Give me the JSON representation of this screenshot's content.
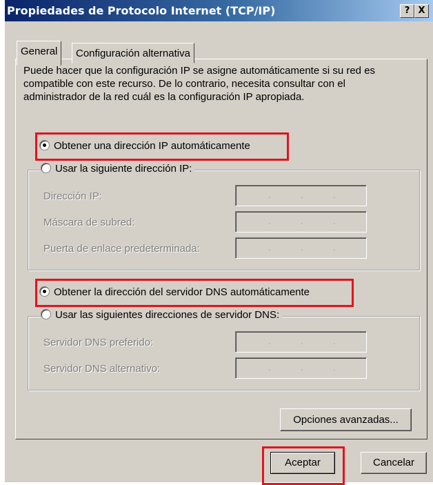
{
  "window": {
    "title": "Propiedades de Protocolo Internet (TCP/IP)",
    "help_label": "?",
    "close_label": "X"
  },
  "tabs": [
    {
      "label": "General"
    },
    {
      "label": "Configuración alternativa"
    }
  ],
  "intro_text": "Puede hacer que la configuración IP se asigne automáticamente si su red es compatible con este recurso. De lo contrario, necesita consultar con el administrador de la red cuál es la configuración IP apropiada.",
  "ip": {
    "auto_label": "Obtener una dirección IP automáticamente",
    "manual_label": "Usar la siguiente dirección IP:",
    "fields": [
      {
        "label": "Dirección IP:"
      },
      {
        "label": "Máscara de subred:"
      },
      {
        "label": "Puerta de enlace predeterminada:"
      }
    ]
  },
  "dns": {
    "auto_label": "Obtener la dirección del servidor DNS automáticamente",
    "manual_label": "Usar las siguientes direcciones de servidor DNS:",
    "fields": [
      {
        "label": "Servidor DNS preferido:"
      },
      {
        "label": "Servidor DNS alternativo:"
      }
    ]
  },
  "advanced_label": "Opciones avanzadas...",
  "ok_label": "Aceptar",
  "cancel_label": "Cancelar",
  "highlight_color": "#e3131d"
}
